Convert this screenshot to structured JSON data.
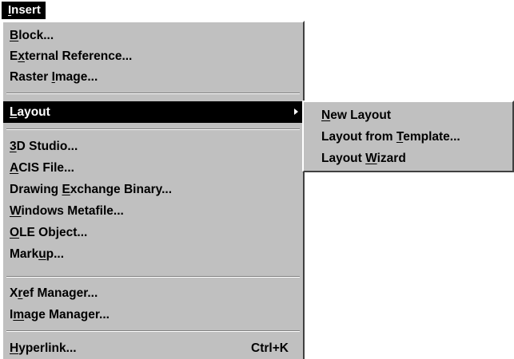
{
  "menubar": {
    "title_prefix": "",
    "title_mnemonic": "I",
    "title_rest": "nsert"
  },
  "menu": {
    "items": [
      {
        "pre": "",
        "key": "B",
        "post": "lock..."
      },
      {
        "pre": "E",
        "key": "x",
        "post": "ternal Reference..."
      },
      {
        "pre": "Raster ",
        "key": "I",
        "post": "mage..."
      },
      {
        "pre": "",
        "key": "L",
        "post": "ayout",
        "has_submenu": true,
        "selected": true
      },
      {
        "pre": "",
        "key": "3",
        "post": "D Studio..."
      },
      {
        "pre": "",
        "key": "A",
        "post": "CIS File..."
      },
      {
        "pre": "Drawing ",
        "key": "E",
        "post": "xchange Binary..."
      },
      {
        "pre": "",
        "key": "W",
        "post": "indows Metafile..."
      },
      {
        "pre": "",
        "key": "O",
        "post": "LE Object..."
      },
      {
        "pre": "Mark",
        "key": "u",
        "post": "p..."
      },
      {
        "pre": "X",
        "key": "r",
        "post": "ef Manager..."
      },
      {
        "pre": "I",
        "key": "m",
        "post": "age Manager..."
      },
      {
        "pre": "",
        "key": "H",
        "post": "yperlink...",
        "shortcut": "Ctrl+K"
      }
    ]
  },
  "submenu": {
    "items": [
      {
        "pre": "",
        "key": "N",
        "post": "ew Layout"
      },
      {
        "pre": "Layout from ",
        "key": "T",
        "post": "emplate..."
      },
      {
        "pre": "Layout ",
        "key": "W",
        "post": "izard"
      }
    ]
  },
  "colors": {
    "menu_bg": "#c0c0c0",
    "highlight_bg": "#000000",
    "highlight_fg": "#ffffff"
  }
}
